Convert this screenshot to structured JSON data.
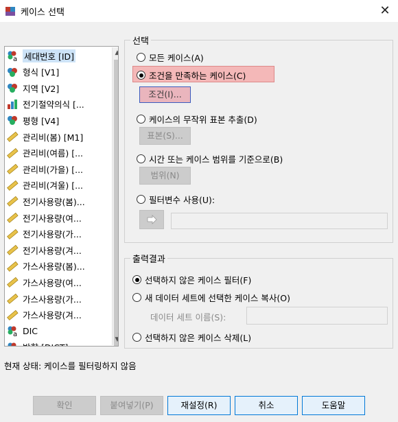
{
  "window": {
    "title": "케이스 선택",
    "close_label": "✕"
  },
  "variables": [
    {
      "label": "세대번호 [ID]",
      "icon": "nominal-string-icon",
      "selected": true
    },
    {
      "label": "형식 [V1]",
      "icon": "nominal-icon"
    },
    {
      "label": "지역 [V2]",
      "icon": "nominal-icon"
    },
    {
      "label": "전기절약의식 [...",
      "icon": "ordinal-icon"
    },
    {
      "label": "평형 [V4]",
      "icon": "nominal-icon"
    },
    {
      "label": "관리비(봄) [M1]",
      "icon": "scale-icon"
    },
    {
      "label": "관리비(여름) [...",
      "icon": "scale-icon"
    },
    {
      "label": "관리비(가을) [...",
      "icon": "scale-icon"
    },
    {
      "label": "관리비(겨울) [...",
      "icon": "scale-icon"
    },
    {
      "label": "전기사용량(봄)...",
      "icon": "scale-icon"
    },
    {
      "label": "전기사용량(여...",
      "icon": "scale-icon"
    },
    {
      "label": "전기사용량(가...",
      "icon": "scale-icon"
    },
    {
      "label": "전기사용량(겨...",
      "icon": "scale-icon"
    },
    {
      "label": "가스사용량(봄)...",
      "icon": "scale-icon"
    },
    {
      "label": "가스사용량(여...",
      "icon": "scale-icon"
    },
    {
      "label": "가스사용량(가...",
      "icon": "scale-icon"
    },
    {
      "label": "가스사용량(겨...",
      "icon": "scale-icon"
    },
    {
      "label": "DIC",
      "icon": "nominal-string-icon"
    },
    {
      "label": "방향 [DICT]",
      "icon": "nominal-string-icon"
    }
  ],
  "select_group": {
    "label": "선택",
    "all_cases": "모든 케이스(A)",
    "if_condition": "조건을 만족하는 케이스(C)",
    "if_button": "조건(I)...",
    "random_sample": "케이스의 무작위 표본 추출(D)",
    "sample_button": "표본(S)...",
    "based_on_time": "시간 또는 케이스 범위를 기준으로(B)",
    "range_button": "범위(N)",
    "use_filter": "필터변수 사용(U):"
  },
  "output_group": {
    "label": "출력결과",
    "filter_out": "선택하지 않은 케이스 필터(F)",
    "copy_to_dataset": "새 데이터 세트에 선택한 케이스 복사(O)",
    "dataset_name_label": "데이터 세트 이름(S):",
    "delete_unselected": "선택하지 않은 케이스 삭제(L)"
  },
  "status": "현재 상태: 케이스를 필터링하지 않음",
  "buttons": {
    "ok": "확인",
    "paste": "붙여넣기(P)",
    "reset": "재설정(R)",
    "cancel": "취소",
    "help": "도움말"
  }
}
